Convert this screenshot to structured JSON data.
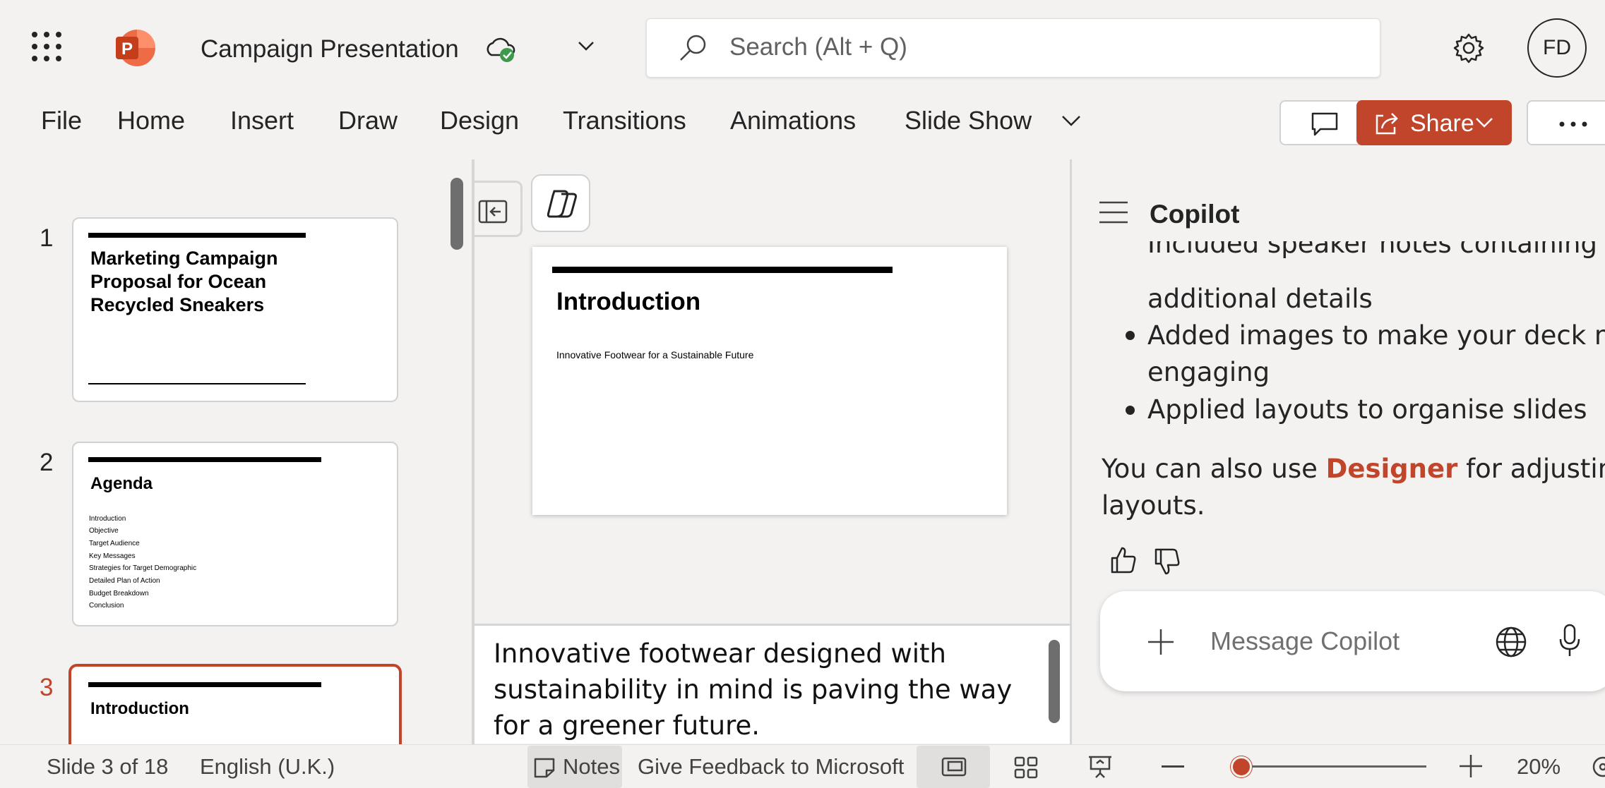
{
  "app": {
    "title": "Campaign Presentation",
    "brand_color": "#c0452b",
    "app_icon": "powerpoint-icon",
    "launcher_icon": "app-launcher-icon",
    "cloud_icon": "cloud-saved-icon"
  },
  "search": {
    "placeholder": "Search (Alt + Q)",
    "icon": "search-icon"
  },
  "user": {
    "initials": "FD",
    "settings_icon": "gear-icon"
  },
  "ribbon": {
    "tabs": [
      "File",
      "Home",
      "Insert",
      "Draw",
      "Design",
      "Transitions",
      "Animations",
      "Slide Show"
    ],
    "share_label": "Share",
    "comment_icon": "comment-icon",
    "more_icon": "ellipsis-icon"
  },
  "thumbnails": [
    {
      "number": "1",
      "title": "Marketing Campaign Proposal for Ocean Recycled Sneakers"
    },
    {
      "number": "2",
      "title": "Agenda",
      "items": [
        "Introduction",
        "Objective",
        "Target Audience",
        "Key Messages",
        "Strategies for Target Demographic",
        "Detailed Plan of Action",
        "Budget Breakdown",
        "Conclusion"
      ]
    },
    {
      "number": "3",
      "title": "Introduction",
      "selected": true
    }
  ],
  "slide": {
    "title": "Introduction",
    "subtitle": "Innovative Footwear for a Sustainable Future"
  },
  "notes": {
    "text": "Innovative footwear designed with sustainability in mind is paving the way for a greener future."
  },
  "copilot": {
    "title": "Copilot",
    "partial_line": "Included speaker notes containing",
    "partial_line_cont": "additional details",
    "bullets": [
      {
        "line1": "Added images to make your deck more",
        "line2": "engaging"
      },
      {
        "line1": "Applied layouts to organise slides",
        "line2": ""
      }
    ],
    "tip_before": "You can also use ",
    "tip_link": "Designer",
    "tip_after": " for adjusting",
    "tip_line2": "layouts.",
    "message_placeholder": "Message Copilot"
  },
  "status": {
    "slide_info": "Slide 3 of 18",
    "language": "English (U.K.)",
    "notes_label": "Notes",
    "feedback": "Give Feedback to Microsoft",
    "zoom": "20%",
    "zoom_level": 0.05
  }
}
